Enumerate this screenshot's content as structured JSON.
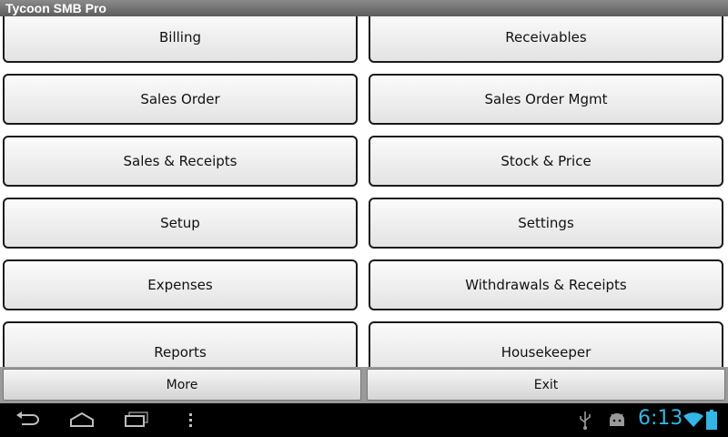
{
  "app": {
    "title": "Tycoon SMB Pro"
  },
  "menu": {
    "left": [
      "Billing",
      "Sales Order",
      "Sales & Receipts",
      "Setup",
      "Expenses",
      "Reports"
    ],
    "right": [
      "Receivables",
      "Sales Order Mgmt",
      "Stock & Price",
      "Settings",
      "Withdrawals & Receipts",
      "Housekeeper"
    ]
  },
  "bottom": {
    "more_label": "More",
    "exit_label": "Exit"
  },
  "system_bar": {
    "time": "6:13",
    "icons": [
      "back-icon",
      "home-icon",
      "recent-apps-icon",
      "overflow-menu-icon",
      "usb-icon",
      "android-debug-icon",
      "wifi-icon",
      "battery-icon"
    ],
    "accent_color": "#33b5e5"
  }
}
